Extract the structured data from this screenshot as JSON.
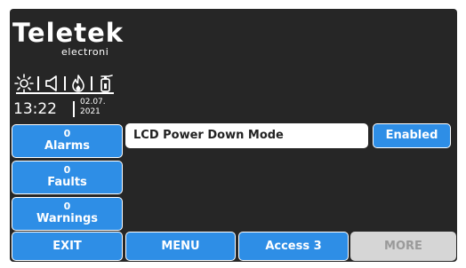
{
  "brand": {
    "name": "Teletek",
    "sub": "electroni"
  },
  "status_icons": [
    "sun-icon",
    "speaker-icon",
    "flame-icon",
    "fire-extinguisher-icon"
  ],
  "clock": {
    "time": "13:22",
    "date_line1": "02.07.",
    "date_line2": "2021"
  },
  "counters": {
    "alarms": {
      "count": "0",
      "label": "Alarms"
    },
    "faults": {
      "count": "0",
      "label": "Faults"
    },
    "warnings": {
      "count": "0",
      "label": "Warnings"
    }
  },
  "setting": {
    "label": "LCD Power Down Mode",
    "value": "Enabled"
  },
  "bottom_bar": {
    "exit": "EXIT",
    "menu": "MENU",
    "access": "Access 3",
    "more": "MORE"
  },
  "colors": {
    "background": "#262626",
    "button": "#2e8ee6",
    "disabled": "#d6d6d6"
  }
}
